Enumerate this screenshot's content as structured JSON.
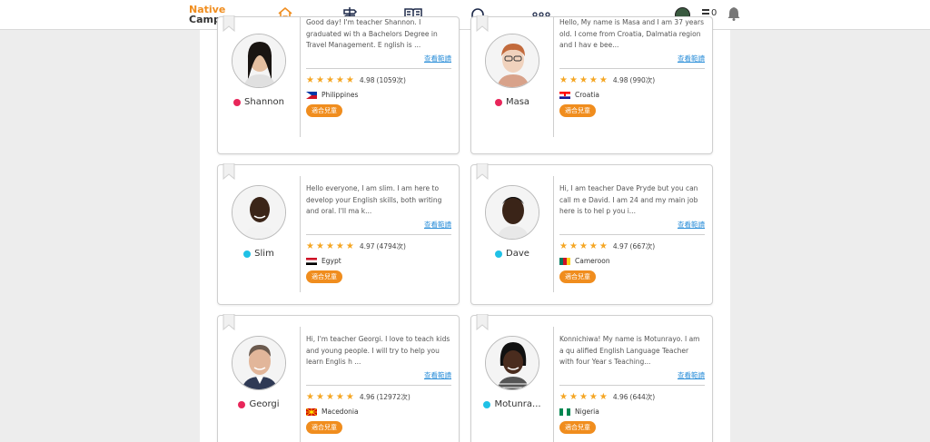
{
  "header": {
    "logo_line1": "Native",
    "logo_line2": "Camp.",
    "nav": [
      {
        "icon": "home-icon",
        "active": true
      },
      {
        "icon": "signpost-icon",
        "active": false
      },
      {
        "icon": "book-icon",
        "active": false
      },
      {
        "icon": "headset-icon",
        "active": false
      },
      {
        "icon": "more-icon",
        "active": false
      }
    ],
    "coins": "0"
  },
  "colors": {
    "brand_orange": "#f08d1e",
    "status_offline": "#e8265a",
    "status_online": "#1fc1e6",
    "star": "#f5a623",
    "link": "#2c8fd9"
  },
  "more_label": "查看範讀",
  "kids_label": "適合兒童",
  "teachers": [
    {
      "name": "Shannon",
      "status": "offline",
      "intro": "Good day! I'm teacher Shannon. I graduated wi th a Bachelors Degree in Travel Management. E nglish is ...",
      "rating": "4.98",
      "reviews": "(1059次)",
      "country": "Philippines",
      "flag": "ph"
    },
    {
      "name": "Masa",
      "status": "offline",
      "intro": "Hello, My name is Masa and I am 37 years old. I come from Croatia, Dalmatia region and I hav e bee...",
      "rating": "4.98",
      "reviews": "(990次)",
      "country": "Croatia",
      "flag": "hr"
    },
    {
      "name": "Slim",
      "status": "online",
      "intro": "Hello everyone, I am slim. I am here to develop your English skills, both writing and oral. I'll ma k...",
      "rating": "4.97",
      "reviews": "(4794次)",
      "country": "Egypt",
      "flag": "eg"
    },
    {
      "name": "Dave",
      "status": "online",
      "intro": "Hi, I am teacher Dave Pryde but you can call m e David. I am 24 and my main job here is to hel p you i...",
      "rating": "4.97",
      "reviews": "(667次)",
      "country": "Cameroon",
      "flag": "cm"
    },
    {
      "name": "Georgi",
      "status": "offline",
      "intro": "Hi, I'm teacher Georgi. I love to teach kids and young people. I will try to help you learn Englis h ...",
      "rating": "4.96",
      "reviews": "(12972次)",
      "country": "Macedonia",
      "flag": "mk"
    },
    {
      "name": "Motunra...",
      "status": "online",
      "intro": "Konnichiwa! My name is Motunrayo. I am a qu alified English Language Teacher with four Year s Teaching...",
      "rating": "4.96",
      "reviews": "(644次)",
      "country": "Nigeria",
      "flag": "ng"
    }
  ]
}
